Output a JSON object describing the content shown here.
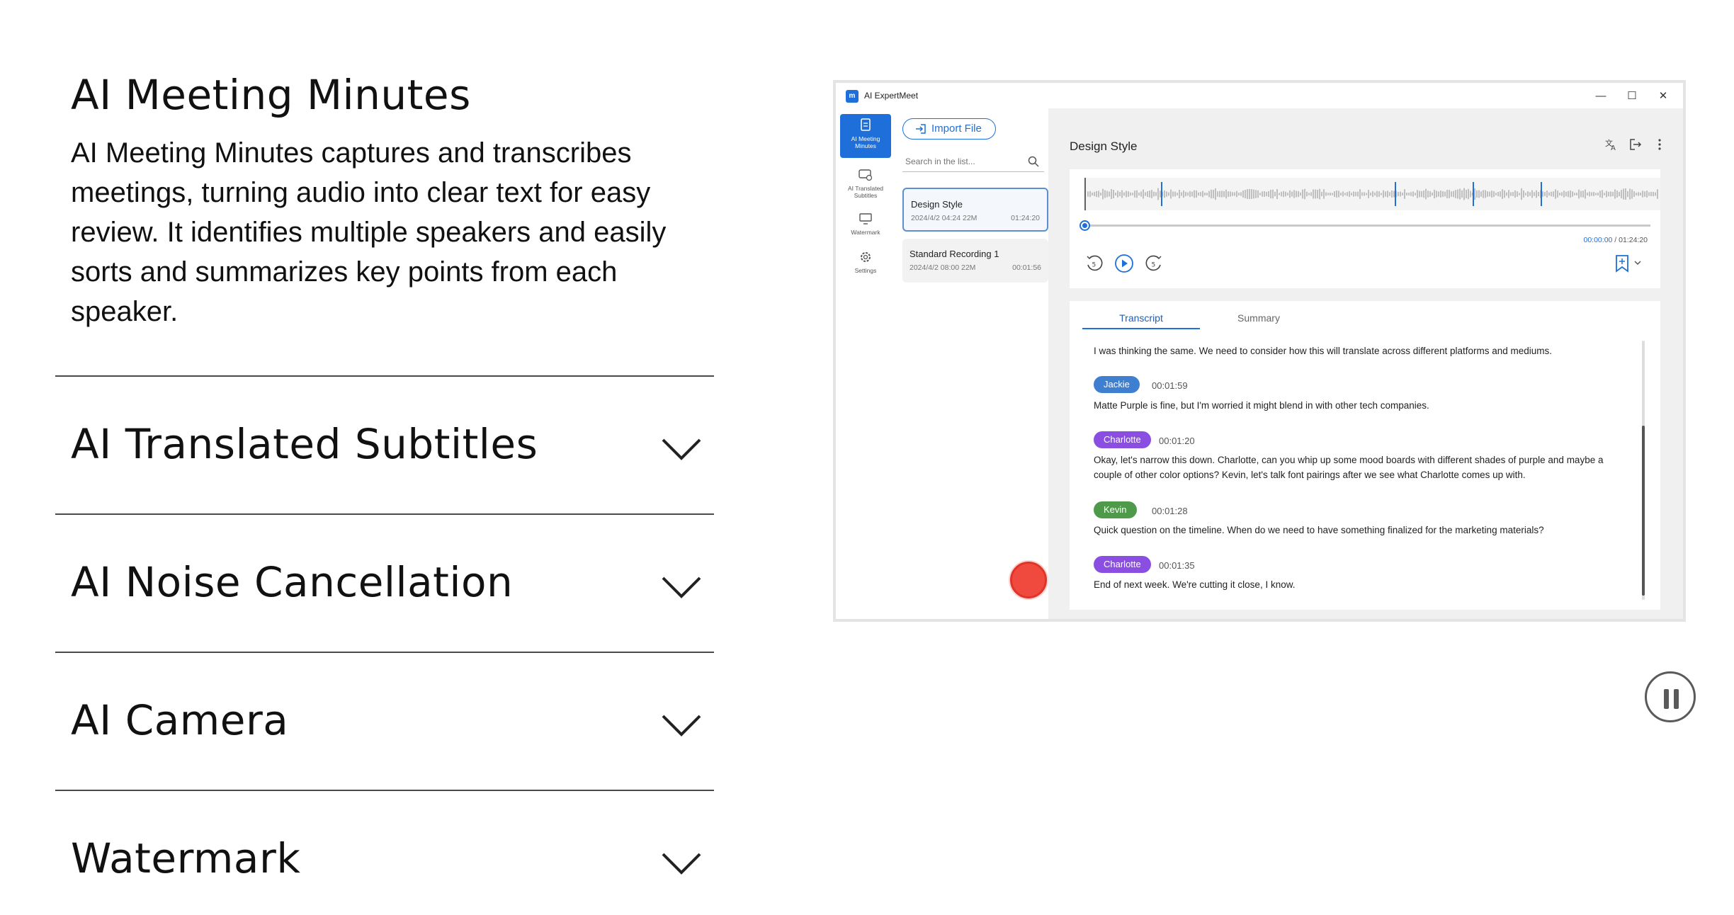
{
  "features": {
    "active": {
      "title": "AI Meeting Minutes",
      "description": "AI Meeting Minutes captures and transcribes meetings, turning audio into clear text for easy review. It identifies multiple speakers and easily sorts and summarizes key points from each speaker."
    },
    "items": [
      {
        "label": "AI Translated Subtitles"
      },
      {
        "label": "AI Noise Cancellation"
      },
      {
        "label": "AI Camera"
      },
      {
        "label": "Watermark"
      }
    ]
  },
  "app": {
    "name": "AI ExpertMeet",
    "logo_text": "m",
    "window": {
      "minimize": "—",
      "maximize": "☐",
      "close": "✕"
    },
    "nav": [
      {
        "label": "AI Meeting Minutes",
        "icon": "document-icon",
        "active": true
      },
      {
        "label": "AI Translated Subtitles",
        "icon": "subtitles-icon",
        "active": false
      },
      {
        "label": "Watermark",
        "icon": "monitor-icon",
        "active": false
      },
      {
        "label": "Settings",
        "icon": "gear-icon",
        "active": false
      }
    ],
    "import_label": "Import File",
    "search_placeholder": "Search in the list...",
    "recordings": [
      {
        "name": "Design Style",
        "meta": "2024/4/2  04:24  22M",
        "duration": "01:24:20",
        "selected": true
      },
      {
        "name": "Standard Recording 1",
        "meta": "2024/4/2  08:00  22M",
        "duration": "00:01:56",
        "selected": false
      }
    ],
    "doc_title": "Design Style",
    "time_current": "00:00:00",
    "time_total": " / 01:24:20",
    "skip_back": "5",
    "skip_forward": "5",
    "tabs": [
      {
        "label": "Transcript",
        "active": true
      },
      {
        "label": "Summary",
        "active": false
      }
    ],
    "transcript": {
      "intro": "I was thinking the same. We need to consider how this will translate across different platforms and mediums.",
      "entries": [
        {
          "speaker": "Jackie",
          "time": "00:01:59",
          "color": "#3f7fd0",
          "text": "Matte Purple is fine, but I'm worried it might blend in with other tech companies."
        },
        {
          "speaker": "Charlotte",
          "time": "00:01:20",
          "color": "#8a4ee0",
          "text": "Okay, let's narrow this down. Charlotte, can you whip up some mood boards with different shades of purple and maybe a couple of other color options? Kevin, let's talk font pairings after we see what Charlotte comes up with."
        },
        {
          "speaker": "Kevin",
          "time": "00:01:28",
          "color": "#4f9a4a",
          "text": "Quick question on the timeline. When do we need to have something finalized for the marketing materials?"
        },
        {
          "speaker": "Charlotte",
          "time": "00:01:35",
          "color": "#8a4ee0",
          "text": "End of next week. We're cutting it close, I know."
        }
      ]
    },
    "accent_color": "#1e6fd9",
    "record_color": "#f04a3e"
  }
}
